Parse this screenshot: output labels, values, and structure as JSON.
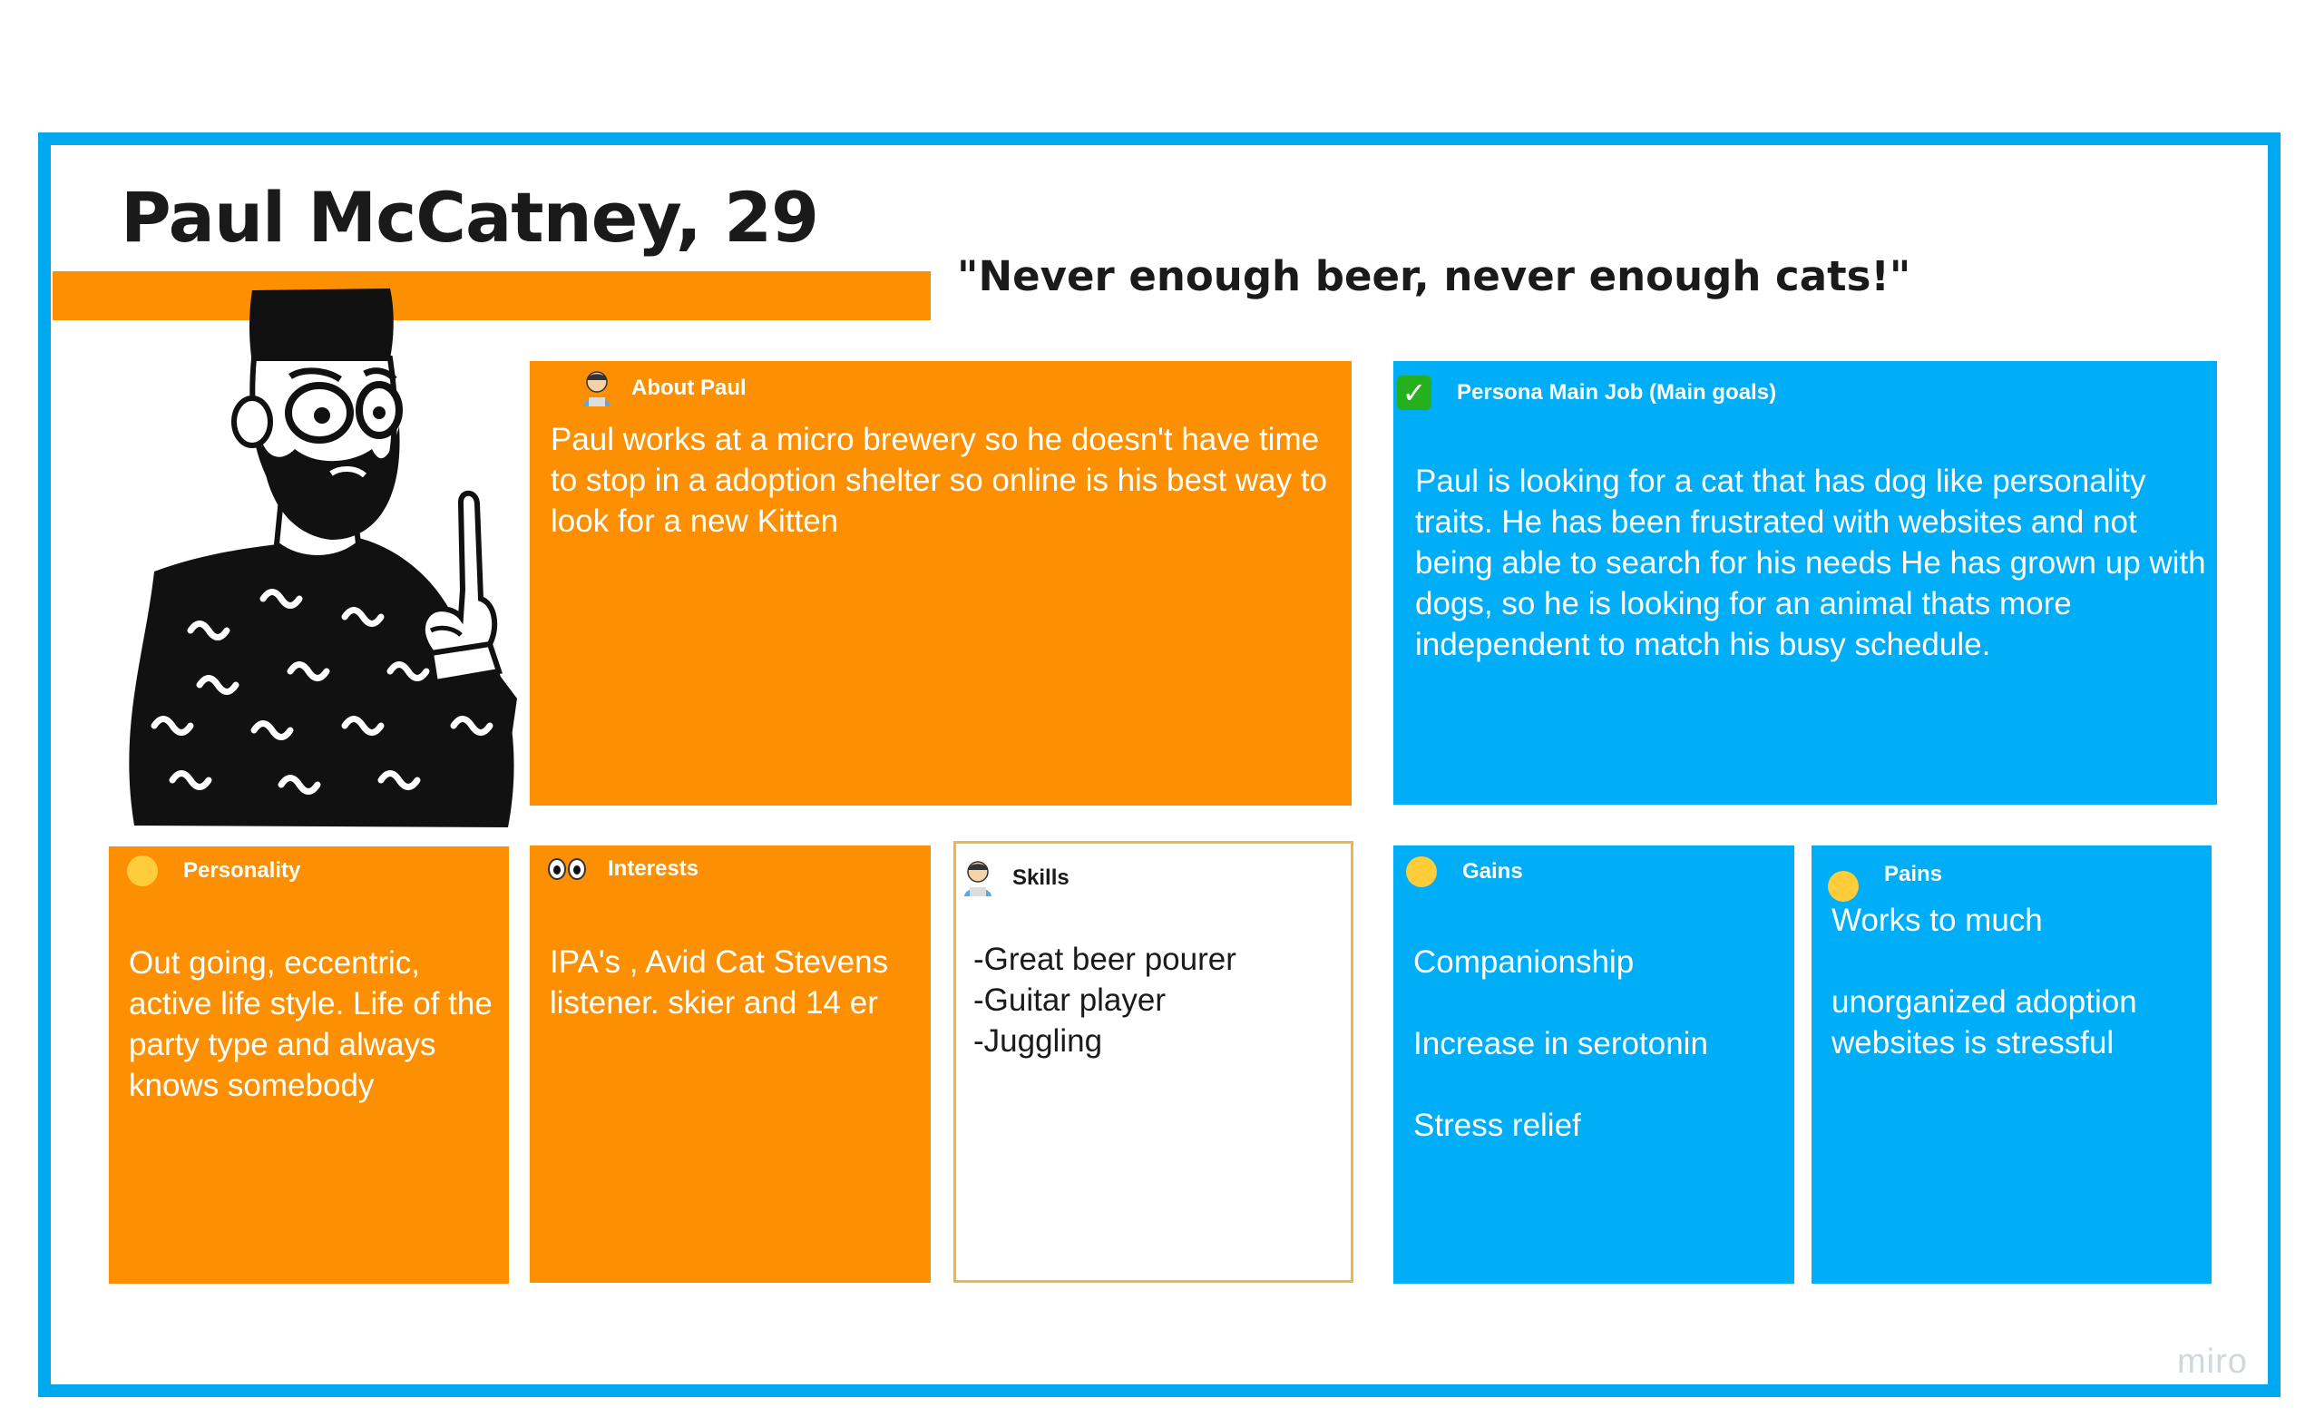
{
  "persona": {
    "name": "Paul McCatney, 29",
    "quote": "\"Never enough beer, never enough cats!\""
  },
  "cards": {
    "about": {
      "title": "About Paul",
      "icon": "man-technologist-icon",
      "lines": [
        "Paul works at a micro brewery so he doesn't have time",
        "to stop in a adoption shelter so online is his best way to",
        "look for a new Kitten"
      ]
    },
    "main_job": {
      "title": "Persona Main Job (Main goals)",
      "icon": "check-mark-icon",
      "lines": [
        "Paul  is looking for a cat that has dog like personality",
        "traits. He has been frustrated with websites and not",
        "being able to search for his needs He has grown up with",
        "dogs, so he is looking for an animal thats more",
        "independent to match his busy schedule."
      ]
    },
    "personality": {
      "title": "Personality",
      "icon": "relieved-face-icon",
      "lines": [
        "Out going, eccentric,",
        "active life style. Life of the",
        "party type and always",
        "knows somebody"
      ]
    },
    "interests": {
      "title": "Interests",
      "icon": "eyes-icon",
      "lines": [
        "IPA's , Avid Cat Stevens",
        "listener. skier and 14 er"
      ]
    },
    "skills": {
      "title": "Skills",
      "icon": "man-technologist-icon",
      "lines": [
        "-Great beer pourer",
        "-Guitar player",
        "-Juggling"
      ]
    },
    "gains": {
      "title": "Gains",
      "icon": "smiling-face-icon",
      "lines": [
        "Companionship",
        "",
        "Increase in serotonin",
        "",
        "Stress relief"
      ]
    },
    "pains": {
      "title": "Pains",
      "icon": "disappointed-face-icon",
      "lines": [
        "Works to much",
        "",
        "unorganized adoption",
        "websites is stressful"
      ]
    }
  },
  "watermark": "miro",
  "colors": {
    "frame_blue": "#00a8f0",
    "card_orange": "#fc9002",
    "card_blue": "#00aef7",
    "skills_border": "#f0b44a"
  }
}
